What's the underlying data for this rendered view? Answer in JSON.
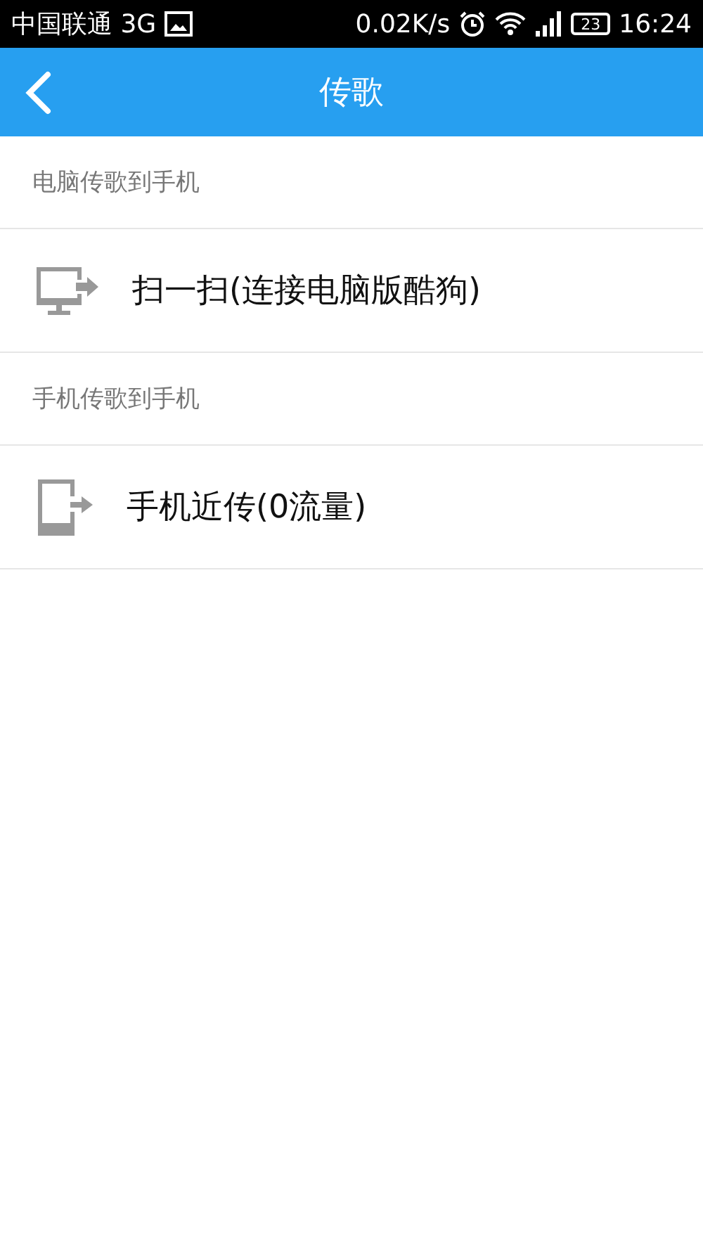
{
  "status_bar": {
    "carrier": "中国联通 3G",
    "speed": "0.02K/s",
    "battery": "23",
    "time": "16:24"
  },
  "header": {
    "title": "传歌"
  },
  "sections": [
    {
      "title": "电脑传歌到手机",
      "items": [
        {
          "kind": "computer",
          "label": "扫一扫(连接电脑版酷狗)"
        }
      ]
    },
    {
      "title": "手机传歌到手机",
      "items": [
        {
          "kind": "phone",
          "label": "手机近传(0流量)"
        }
      ]
    }
  ]
}
